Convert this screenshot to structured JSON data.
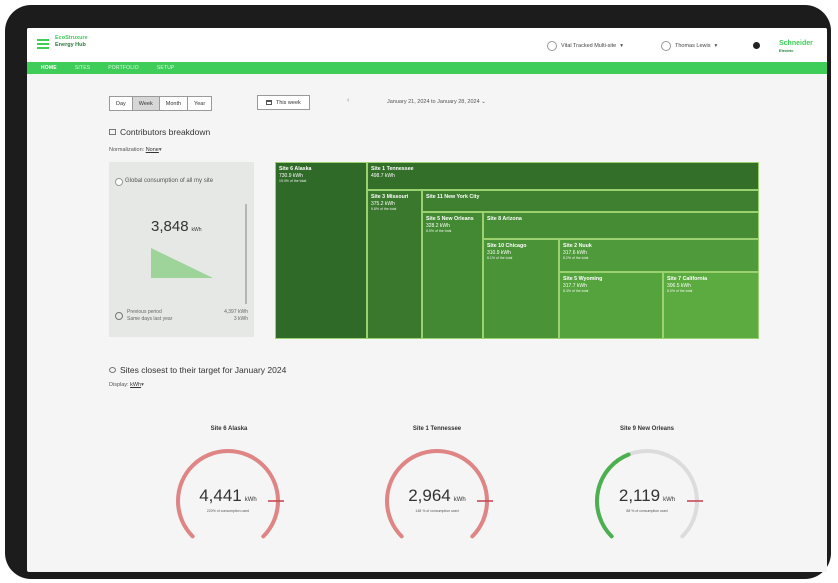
{
  "app": {
    "brand_line1": "EcoStruxure",
    "brand_line2": "Energy Hub",
    "site_selector": "Vital Tracked Multi-site",
    "user_selector": "Thomas Lewis",
    "logo_line1": "Schneider",
    "logo_line2": "Electric",
    "colors": {
      "accent": "#3dcd58",
      "gauge_red": "#e08585",
      "gauge_green": "#4caf50",
      "gauge_track": "#dcdcdc"
    }
  },
  "nav": {
    "tabs": [
      {
        "label": "HOME",
        "active": true
      },
      {
        "label": "SITES",
        "active": false
      },
      {
        "label": "PORTFOLIO",
        "active": false
      },
      {
        "label": "SETUP",
        "active": false
      }
    ]
  },
  "controls": {
    "periods": [
      {
        "label": "Day",
        "active": false
      },
      {
        "label": "Week",
        "active": true
      },
      {
        "label": "Month",
        "active": false
      },
      {
        "label": "Year",
        "active": false
      }
    ],
    "this_week": "This week",
    "date_range": "January 21, 2024 to January 28, 2024"
  },
  "breakdown": {
    "title": "Contributors breakdown",
    "normalization_label": "Normalization:",
    "normalization_value": "None",
    "global_title": "Global consumption of all my site",
    "global_value": "3,848",
    "global_unit": "kWh",
    "previous_period_label": "Previous period",
    "previous_period_value": "4,397 kWh",
    "same_days_label": "Same days last year",
    "same_days_value": "3 kWh"
  },
  "treemap": [
    {
      "name": "Site 6 Alaska",
      "value": "730.9 kWh",
      "pct": "19.0% of the total",
      "color": "#2f6a28"
    },
    {
      "name": "Site 1 Tennessee",
      "value": "498.7 kWh",
      "pct": "",
      "color": "#336f29"
    },
    {
      "name": "Site 3 Missouri",
      "value": "375.2 kWh",
      "pct": "9.8% of the total",
      "color": "#3a782d"
    },
    {
      "name": "Site 11 New York City",
      "value": "",
      "pct": "",
      "color": "#3e7f30"
    },
    {
      "name": "Site 5 New Orleans",
      "value": "328.2 kWh",
      "pct": "8.5% of the total",
      "color": "#438833"
    },
    {
      "name": "Site 8 Arizona",
      "value": "",
      "pct": "",
      "color": "#468c34"
    },
    {
      "name": "Site 10 Chicago",
      "value": "310.9 kWh",
      "pct": "8.1% of the total",
      "color": "#4a9337"
    },
    {
      "name": "Site 2 Nuuk",
      "value": "317.6 kWh",
      "pct": "8.2% of the total",
      "color": "#4f9a3a"
    },
    {
      "name": "Site 5 Wyoming",
      "value": "317.7 kWh",
      "pct": "8.3% of the total",
      "color": "#55a33d"
    },
    {
      "name": "Site 7 California",
      "value": "306.5 kWh",
      "pct": "8.0% of the total",
      "color": "#5cab40"
    }
  ],
  "targets": {
    "title": "Sites closest to their target for January 2024",
    "display_label": "Display:",
    "display_value": "kWh",
    "gauges": [
      {
        "title": "Site 6 Alaska",
        "value": "4,441",
        "unit": "kWh",
        "caption": "220% of consumption used",
        "fraction": 1.0,
        "status": "over"
      },
      {
        "title": "Site 1 Tennessee",
        "value": "2,964",
        "unit": "kWh",
        "caption": "148 % of consumption used",
        "fraction": 1.0,
        "status": "over"
      },
      {
        "title": "Site 9 New Orleans",
        "value": "2,119",
        "unit": "kWh",
        "caption": "88 % of consumption used",
        "fraction": 0.42,
        "status": "ok"
      }
    ]
  }
}
